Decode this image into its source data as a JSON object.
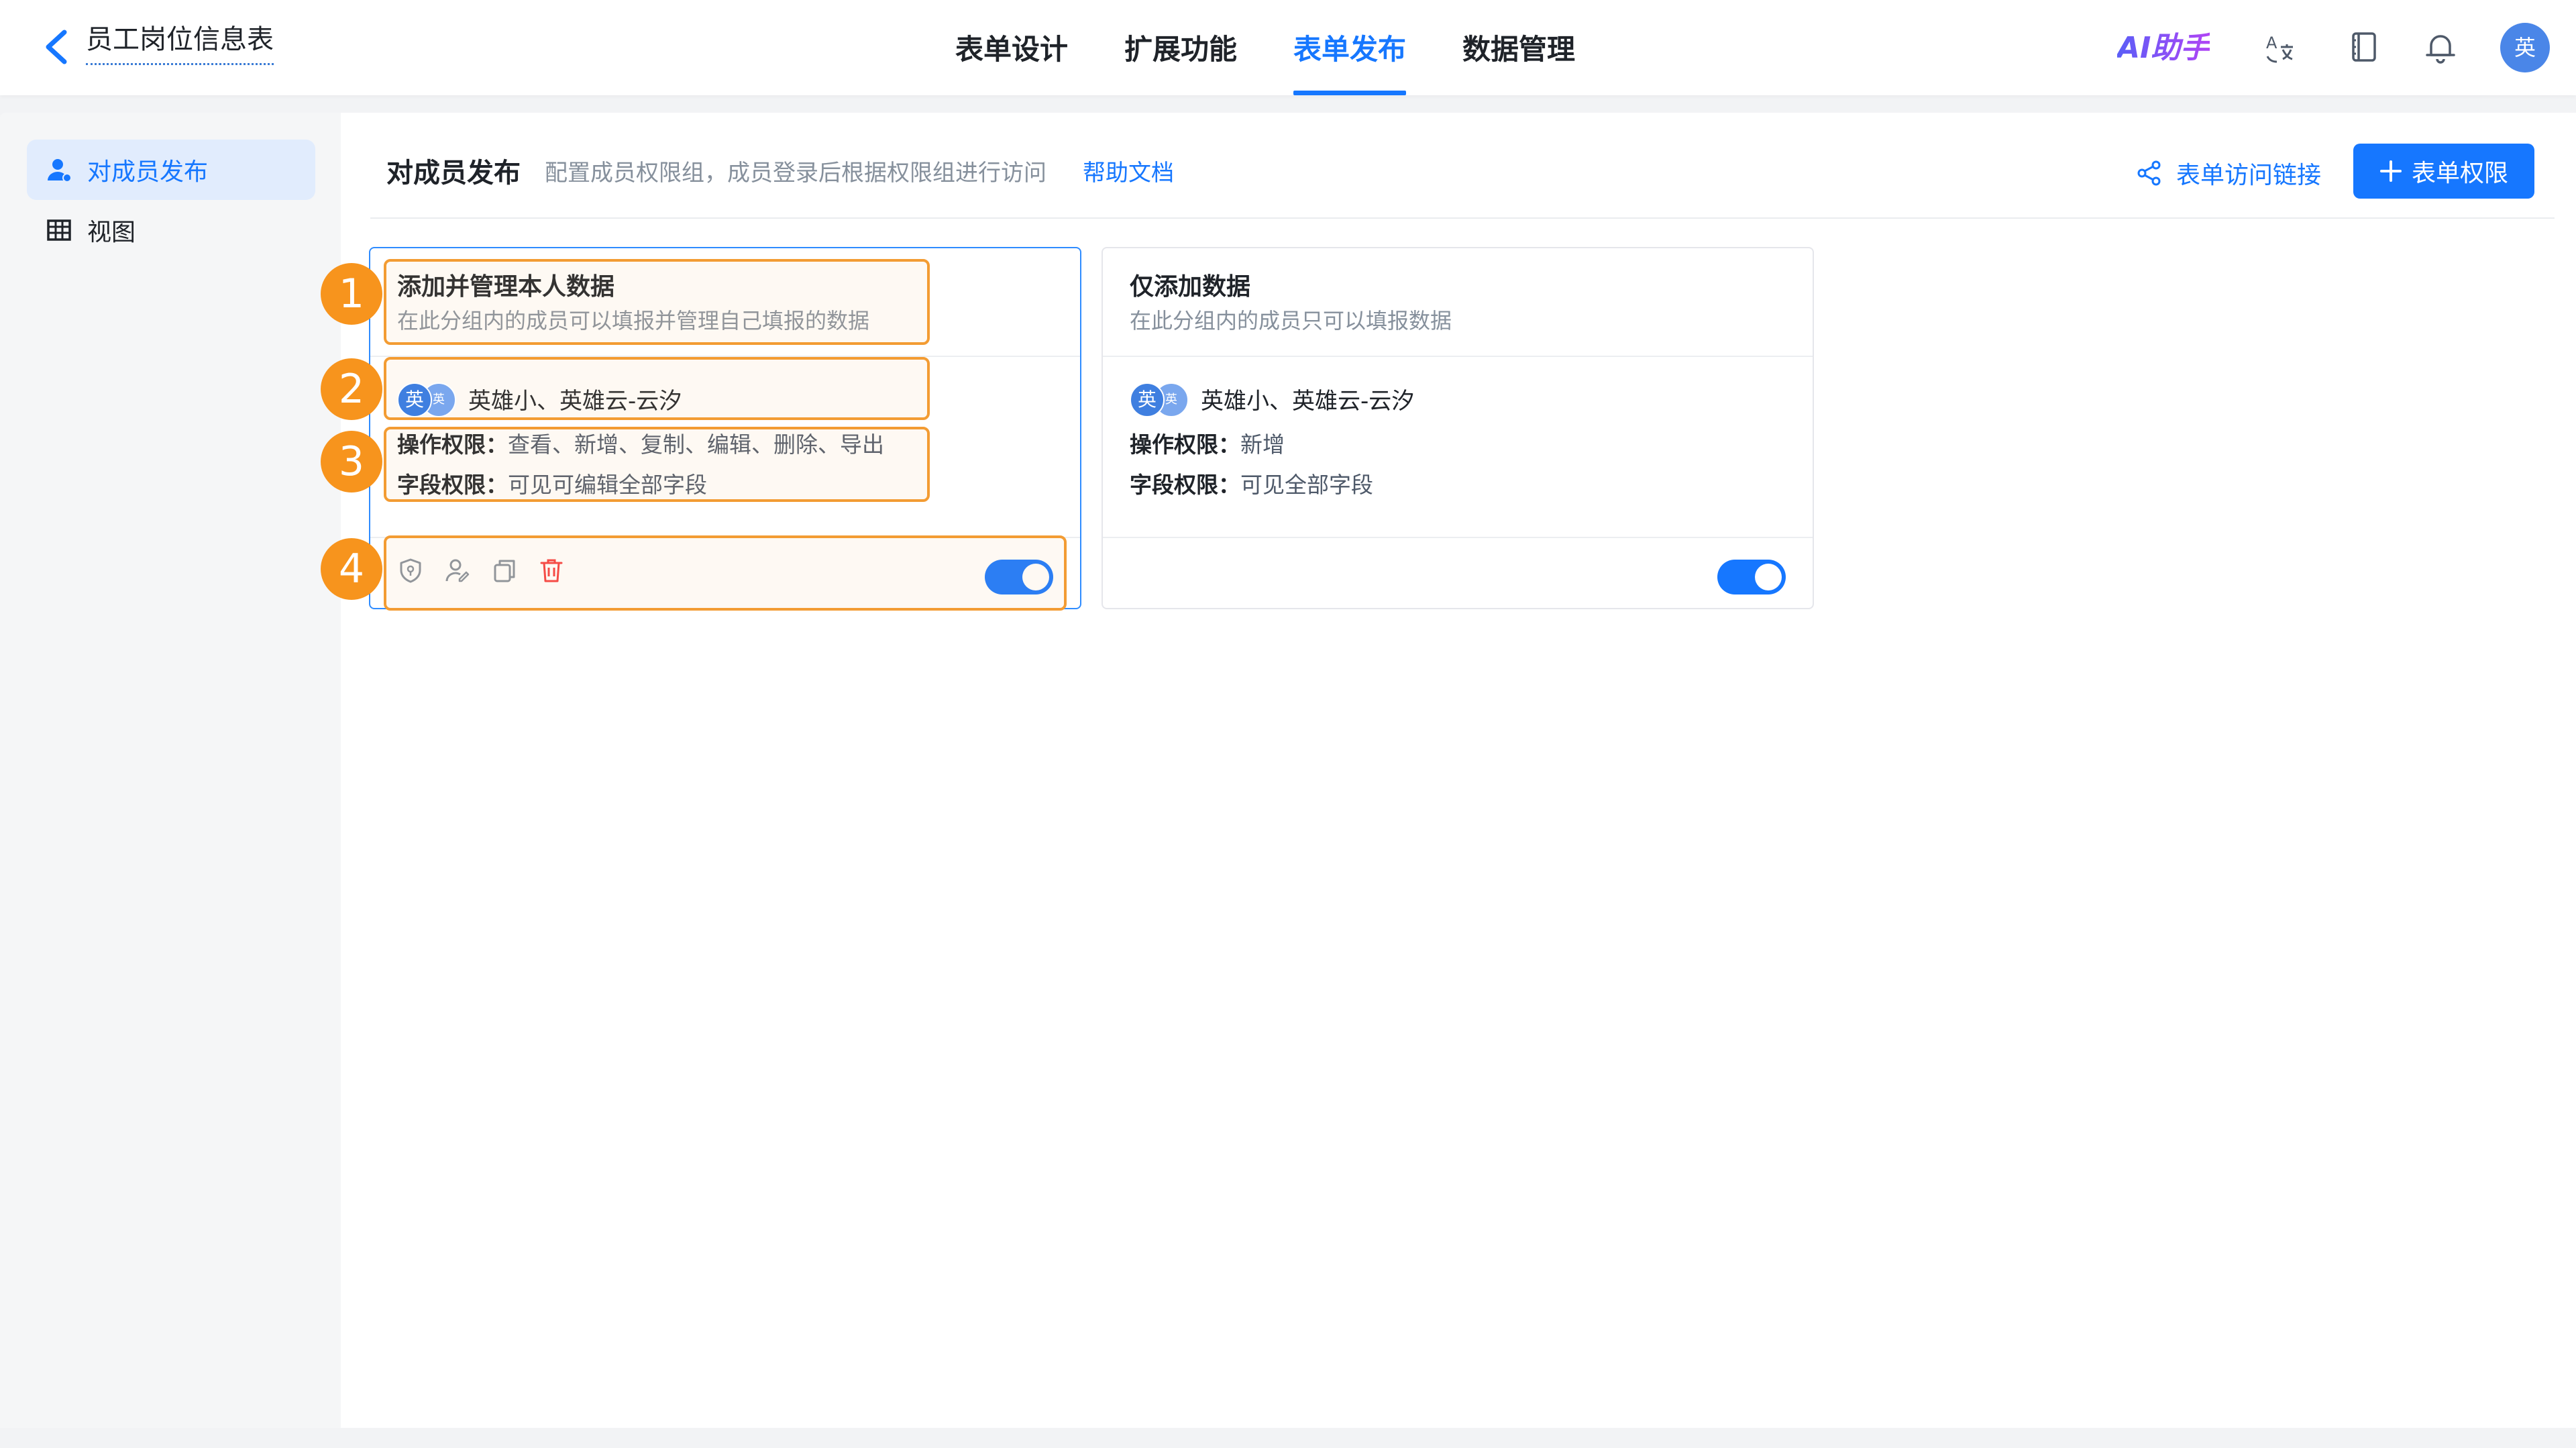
{
  "header": {
    "back_icon": "chevron-left-icon",
    "title": "员工岗位信息表",
    "tabs": [
      {
        "label": "表单设计",
        "active": false
      },
      {
        "label": "扩展功能",
        "active": false
      },
      {
        "label": "表单发布",
        "active": true
      },
      {
        "label": "数据管理",
        "active": false
      }
    ],
    "ai_label": "AI助手",
    "icons": [
      "translate-icon",
      "book-icon",
      "bell-icon"
    ],
    "avatar_text": "英"
  },
  "sidebar": {
    "items": [
      {
        "label": "对成员发布",
        "icon": "user-icon",
        "active": true
      },
      {
        "label": "视图",
        "icon": "table-icon",
        "active": false
      }
    ]
  },
  "main": {
    "title": "对成员发布",
    "description": "配置成员权限组，成员登录后根据权限组进行访问",
    "help_link": "帮助文档",
    "access_link": "表单访问链接",
    "add_button": "表单权限",
    "colors": {
      "accent": "#1677ff",
      "annotation": "#f7941d"
    }
  },
  "cards": [
    {
      "name": "添加并管理本人数据",
      "subtitle": "在此分组内的成员可以填报并管理自己填报的数据",
      "avatar_main": "英",
      "avatar_small": "英",
      "members": "英雄小、英雄云-云汐",
      "op_label": "操作权限：",
      "op_value": "查看、新增、复制、编辑、删除、导出",
      "field_label": "字段权限：",
      "field_value": "可见可编辑全部字段",
      "enabled": true,
      "action_icons": [
        "shield-icon",
        "user-edit-icon",
        "copy-icon",
        "trash-icon"
      ]
    },
    {
      "name": "仅添加数据",
      "subtitle": "在此分组内的成员只可以填报数据",
      "avatar_main": "英",
      "avatar_small": "英",
      "members": "英雄小、英雄云-云汐",
      "op_label": "操作权限：",
      "op_value": "新增",
      "field_label": "字段权限：",
      "field_value": "可见全部字段",
      "enabled": true
    }
  ],
  "annotations": [
    "1",
    "2",
    "3",
    "4"
  ]
}
